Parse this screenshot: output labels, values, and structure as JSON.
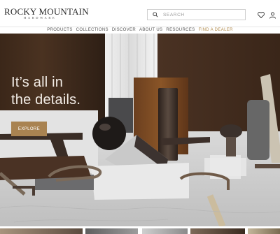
{
  "brand": {
    "name": "Rocky Mountain",
    "subtitle": "HARDWARE"
  },
  "search": {
    "placeholder": "SEARCH"
  },
  "header_icons": [
    "heart-icon",
    "user-icon"
  ],
  "nav": {
    "items": [
      "PRODUCTS",
      "COLLECTIONS",
      "DISCOVER",
      "ABOUT US",
      "RESOURCES"
    ],
    "dealer": "FIND A DEALER",
    "dealer_color": "#b08a4a"
  },
  "hero": {
    "headline_line1": "It’s all in",
    "headline_line2": "the details.",
    "cta": "EXPLORE",
    "cta_color": "#a98351"
  }
}
